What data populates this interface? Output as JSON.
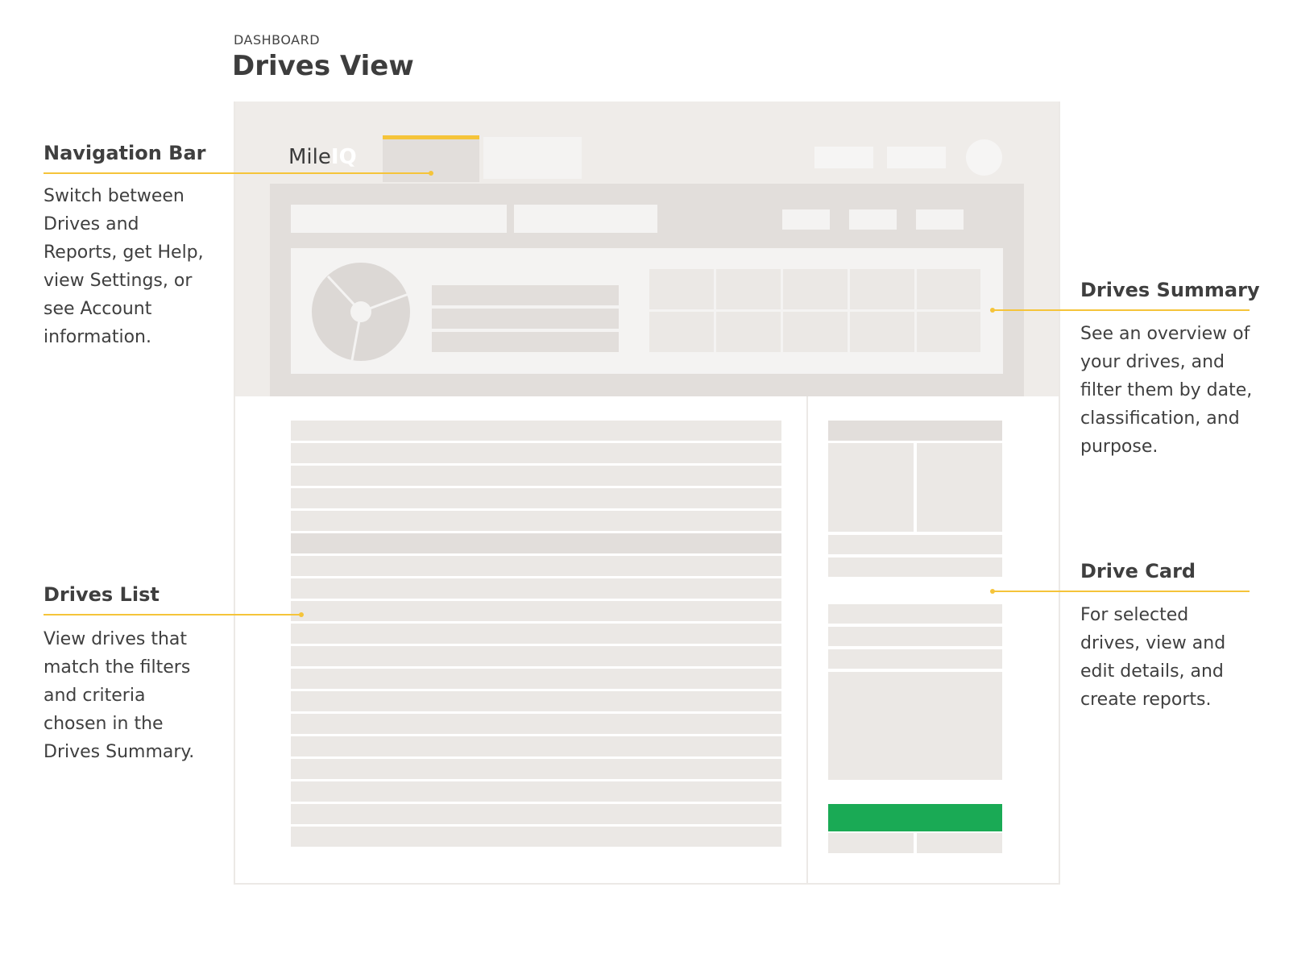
{
  "header": {
    "eyebrow": "DASHBOARD",
    "title": "Drives View"
  },
  "logo": {
    "text": "Mile",
    "mark": "IQ"
  },
  "annotations": [
    {
      "id": "navigation-bar",
      "title": "Navigation Bar",
      "body_lines": [
        "Switch between",
        "Drives and",
        "Reports, get Help,",
        "view Settings, or",
        "see Account",
        "information."
      ]
    },
    {
      "id": "drives-list",
      "title": "Drives List",
      "body_lines": [
        "View drives that",
        "match the filters",
        "and criteria",
        "chosen in the",
        "Drives Summary."
      ]
    },
    {
      "id": "drives-summary",
      "title": "Drives Summary",
      "body_lines": [
        "See an overview of",
        "your drives, and",
        "filter them by date,",
        "classification, and",
        "purpose."
      ]
    },
    {
      "id": "drive-card",
      "title": "Drive Card",
      "body_lines": [
        "For selected",
        "drives, view and",
        "edit details, and",
        "create reports."
      ]
    }
  ],
  "colors": {
    "accent": "#f5c43a",
    "action": "#1aaa55",
    "frame": "#efece9",
    "panel": "#e2dedb"
  }
}
